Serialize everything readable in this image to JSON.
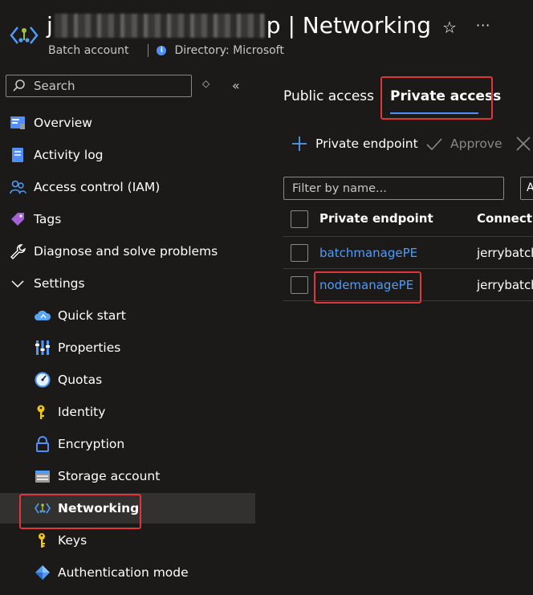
{
  "header": {
    "title_prefix": "j",
    "title_suffix": "p | Networking",
    "resource_type": "Batch account",
    "directory": "Directory: Microsoft",
    "star_icon": "star-icon",
    "more_icon": "more-icon"
  },
  "sidebar": {
    "search_placeholder": "Search",
    "items": [
      {
        "label": "Overview",
        "icon": "overview-icon"
      },
      {
        "label": "Activity log",
        "icon": "activity-log-icon"
      },
      {
        "label": "Access control (IAM)",
        "icon": "people-icon"
      },
      {
        "label": "Tags",
        "icon": "tag-icon"
      },
      {
        "label": "Diagnose and solve problems",
        "icon": "wrench-icon"
      },
      {
        "label": "Settings",
        "icon": "chevron-down-icon"
      },
      {
        "label": "Quick start",
        "icon": "cloud-icon"
      },
      {
        "label": "Properties",
        "icon": "properties-icon"
      },
      {
        "label": "Quotas",
        "icon": "gauge-icon"
      },
      {
        "label": "Identity",
        "icon": "key-identity-icon"
      },
      {
        "label": "Encryption",
        "icon": "lock-icon"
      },
      {
        "label": "Storage account",
        "icon": "storage-icon"
      },
      {
        "label": "Networking",
        "icon": "networking-icon"
      },
      {
        "label": "Keys",
        "icon": "key-icon"
      },
      {
        "label": "Authentication mode",
        "icon": "auth-mode-icon"
      }
    ],
    "active_item": "Networking"
  },
  "tabs": [
    {
      "label": "Public access",
      "selected": false
    },
    {
      "label": "Private access",
      "selected": true
    }
  ],
  "toolbar": {
    "add_label": "Private endpoint",
    "approve_label": "Approve"
  },
  "filter": {
    "placeholder": "Filter by name...",
    "second_filter_text": "A"
  },
  "table": {
    "columns": [
      "Private endpoint",
      "Connectio"
    ],
    "rows": [
      {
        "endpoint": "batchmanagePE",
        "connection": "jerrybatch"
      },
      {
        "endpoint": "nodemanagePE",
        "connection": "jerrybatch"
      }
    ]
  },
  "colors": {
    "background": "#1b1a19",
    "accent": "#4f8ff7",
    "link": "#4f9cf7",
    "highlight": "#e0353b",
    "active_row": "#323130"
  }
}
